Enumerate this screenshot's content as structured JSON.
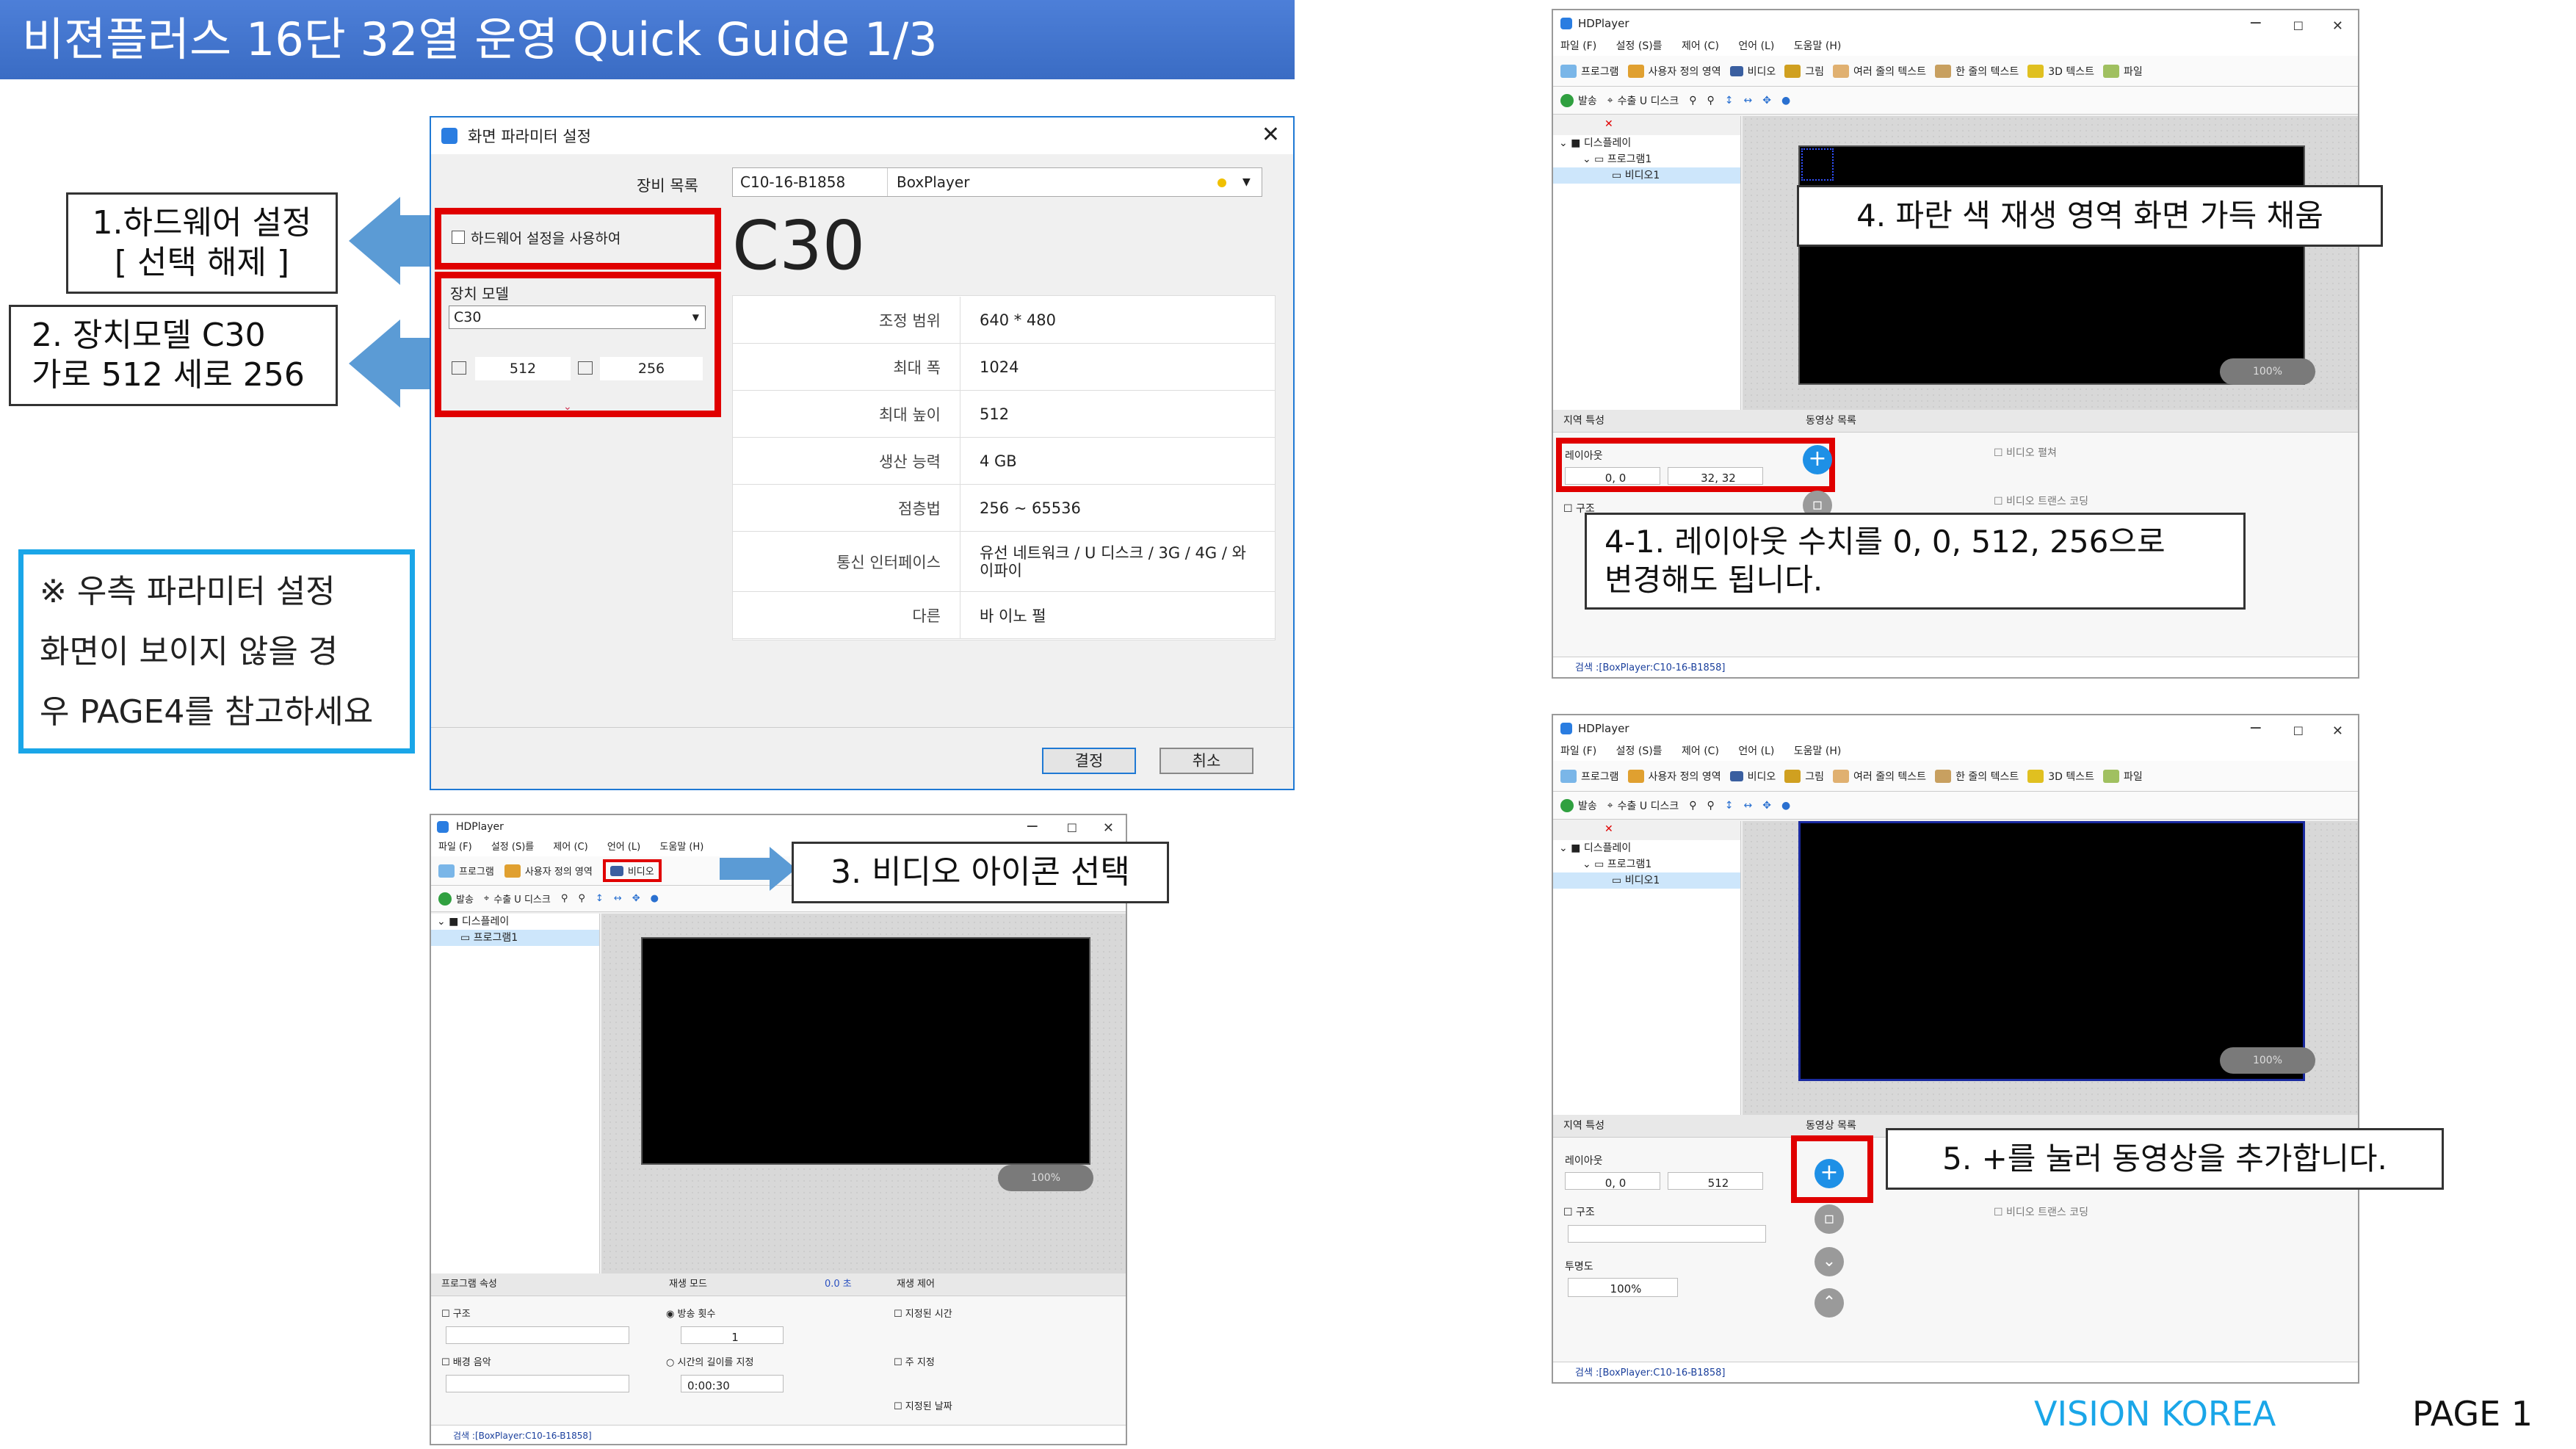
{
  "banner": {
    "title": "비젼플러스 16단 32열 운영 Quick Guide 1/3"
  },
  "callouts": {
    "hw_line1": "1.하드웨어 설정",
    "hw_line2": "[ 선택 해제 ]",
    "model_line1": "2. 장치모델 C30",
    "model_line2": "가로 512 세로 256",
    "note_line1": "※ 우측 파라미터 설정",
    "note_line2": "화면이 보이지 않을 경",
    "note_line3": "우 PAGE4를 참고하세요",
    "step3": "3. 비디오 아이콘 선택",
    "step4": "4. 파란 색 재생 영역 화면 가득 채움",
    "step41_line1": "4-1. 레이아웃 수치를 0, 0, 512, 256으로",
    "step41_line2": "변경해도 됩니다.",
    "step5": "5. +를 눌러 동영상을 추가합니다."
  },
  "param_dialog": {
    "title": "화면 파라미터 설정",
    "close": "✕",
    "device_list_label": "장비 목록",
    "device_id": "C10-16-B1858",
    "device_name": "BoxPlayer",
    "hw_checkbox_label": "하드웨어 설정을 사용하여",
    "device_model_label": "장치 모델",
    "device_model_value": "C30",
    "width_value": "512",
    "height_value": "256",
    "model_big": "C30",
    "specs": [
      {
        "key": "조정 범위",
        "value": "640 * 480"
      },
      {
        "key": "최대 폭",
        "value": "1024"
      },
      {
        "key": "최대 높이",
        "value": "512"
      },
      {
        "key": "생산 능력",
        "value": "4 GB"
      },
      {
        "key": "점층법",
        "value": "256 ~ 65536"
      },
      {
        "key": "통신 인터페이스",
        "value": "유선 네트워크 / U 디스크 / 3G / 4G / 와이파이"
      },
      {
        "key": "다른",
        "value": "바 이노 펄"
      }
    ],
    "ok_button": "결정",
    "cancel_button": "취소"
  },
  "hdplayer": {
    "app_title": "HDPlayer",
    "menu": [
      "파일 (F)",
      "설정 (S)를",
      "제어 (C)",
      "언어 (L)",
      "도움말 (H)"
    ],
    "toolbar": [
      "프로그램",
      "사용자 정의 영역",
      "비디오",
      "그림",
      "여러 줄의 텍스트",
      "한 줄의 텍스트",
      "3D 텍스트",
      "파일"
    ],
    "toolbar2": [
      "발송",
      "수출 U 디스크"
    ],
    "tree": [
      "디스플레이",
      "프로그램1",
      "비디오1"
    ],
    "zoom": "100%",
    "area_props": "지역 특성",
    "video_list": "동영상 목록",
    "layout_label": "레이아웃",
    "layout_xy": "0, 0",
    "layout_wh_default": "32, 32",
    "layout_w": "512",
    "frame_label": "구조",
    "opacity_label": "투명도",
    "opacity_value": "100%",
    "video_stretch": "비디오 펼쳐",
    "video_transcode": "비디오 트랜스 코딩",
    "status": "검색 :[BoxPlayer:C10-16-B1858]",
    "prog_props": "프로그램 속성",
    "play_mode": "재생 모드",
    "play_mode_value": "0.0 초",
    "play_control": "재생 제어",
    "prog_frame": "구조",
    "bg_music": "배경 음악",
    "play_count": "방송 횟수",
    "play_count_value": "1",
    "specified_duration": "시간의 길이를 지정",
    "duration_value": "0:00:30",
    "specified_time": "지정된 시간",
    "weekday": "주 지정",
    "specified_date": "지정된 날짜"
  },
  "footer": {
    "brand": "VISION KOREA",
    "page": "PAGE 1"
  },
  "colors": {
    "banner": "#3f71c9",
    "callout_arrow": "#5b9bd5",
    "note_border": "#1aa6e8",
    "red_highlight": "#e00000",
    "brand_text": "#1aa6e8"
  }
}
